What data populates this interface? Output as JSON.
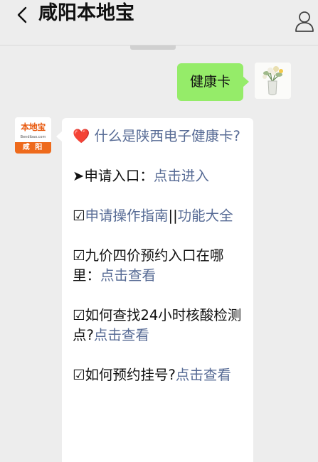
{
  "header": {
    "title": "咸阳本地宝"
  },
  "messages": {
    "outgoing": {
      "text": "健康卡"
    },
    "incoming": {
      "avatar": {
        "brand": "本地宝",
        "url": "Bendibao.com",
        "city": "咸 阳"
      },
      "items": [
        {
          "icon": "❤️",
          "link": "什么是陕西电子健康卡?"
        },
        {
          "icon": "➤",
          "label": "申请入口：",
          "link": "点击进入"
        },
        {
          "icon": "☑",
          "link": "申请操作指南",
          "separator": "||",
          "link2": "功能大全"
        },
        {
          "icon": "☑",
          "label": "九价四价预约入口在哪里：",
          "link": "点击查看"
        },
        {
          "icon": "☑",
          "label": "如何查找24小时核酸检测点?",
          "link": "点击查看"
        },
        {
          "icon": "☑",
          "label": "如何预约挂号?",
          "link": "点击查看"
        }
      ]
    }
  },
  "colors": {
    "background": "#ededed",
    "outgoing_bubble": "#95ec69",
    "incoming_bubble": "#ffffff",
    "link": "#576b95",
    "brand_orange": "#ee6a1c"
  }
}
